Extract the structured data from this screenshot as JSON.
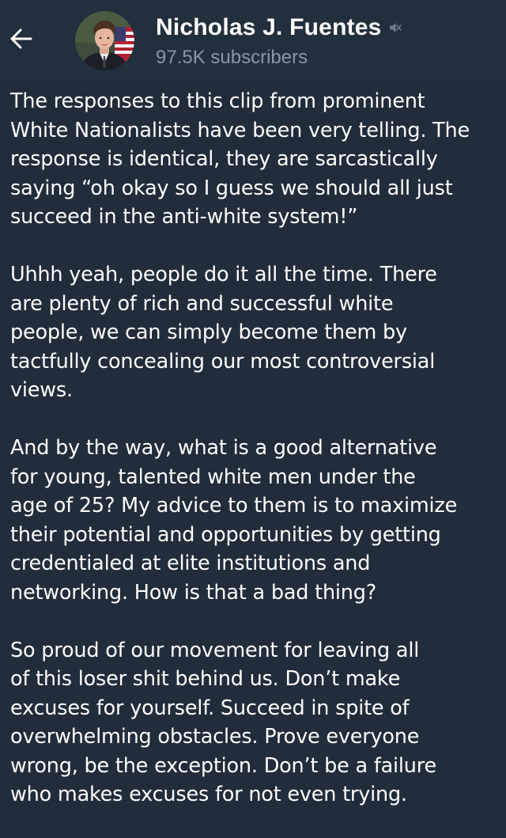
{
  "header": {
    "channel_name": "Nicholas J. Fuentes",
    "subscribers": "97.5K subscribers",
    "back_icon": "arrow-left-icon",
    "mute_icon": "muted-speaker-icon",
    "avatar_icon": "channel-avatar"
  },
  "post": {
    "paragraphs": [
      {
        "lines": [
          "The responses to this clip from prominent",
          "White Nationalists have been very telling. The",
          "response is identical, they are sarcastically",
          "saying “oh okay so I guess we should all just",
          "succeed in the anti-white system!”"
        ]
      },
      {
        "lines": [
          "Uhhh yeah, people do it all the time. There",
          "are plenty of rich and successful white",
          "people, we can simply become them by",
          "tactfully concealing our most controversial",
          "views."
        ]
      },
      {
        "lines": [
          "And by the way, what is a good alternative",
          "for young, talented white men under the",
          "age of 25? My advice to them is to maximize",
          "their potential and opportunities by getting",
          "credentialed at elite institutions and",
          "networking. How is that a bad thing?"
        ]
      },
      {
        "lines": [
          "So proud of our movement for leaving all",
          "of this loser shit behind us. Don’t make",
          "excuses for yourself. Succeed in spite of",
          "overwhelming obstacles. Prove everyone",
          "wrong, be the exception. Don’t be a failure",
          "who makes excuses for not even trying."
        ]
      }
    ]
  },
  "colors": {
    "background": "#212d3b",
    "header_background": "#222f3d",
    "text": "#ffffff",
    "secondary_text": "#8b97a4"
  }
}
